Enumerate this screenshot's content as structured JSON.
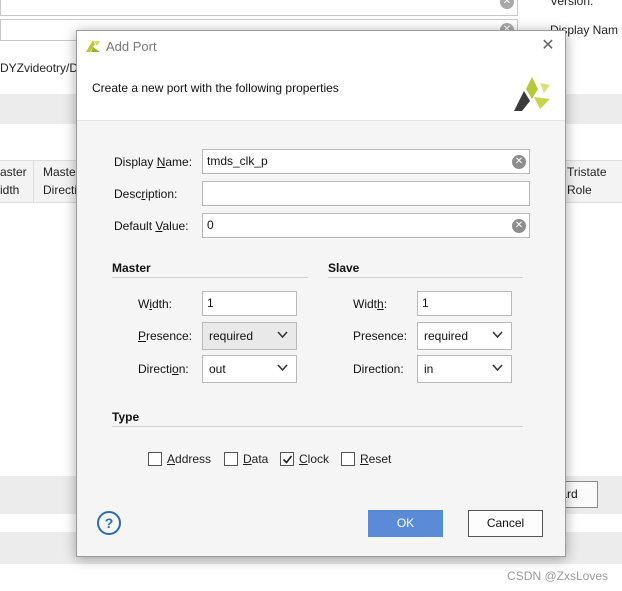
{
  "background": {
    "top_right_label_1": "Version:",
    "top_right_label_2": "Display Nam",
    "path_text": "DYZvideotry/DV",
    "columns_left": [
      {
        "line1": "aster",
        "line2": "idth"
      },
      {
        "line1": "Maste",
        "line2": "Directi"
      }
    ],
    "column_right": {
      "line1": "Tristate",
      "line2": "Role"
    },
    "button_fragment": "ard"
  },
  "watermark": "CSDN @ZxsLoves",
  "dialog": {
    "title": "Add Port",
    "subtitle": "Create a new port with the following properties",
    "fields": {
      "display_name": {
        "label_pre": "Display ",
        "label_key": "N",
        "label_post": "ame:",
        "value": "tmds_clk_p"
      },
      "description": {
        "label_pre": "Desc",
        "label_key": "r",
        "label_post": "iption:",
        "value": ""
      },
      "default_value": {
        "label_pre": "Default ",
        "label_key": "V",
        "label_post": "alue:",
        "value": "0"
      }
    },
    "master": {
      "title": "Master",
      "width_label_pre": "W",
      "width_label_key": "i",
      "width_label_post": "dth:",
      "width_value": "1",
      "presence_label_pre": "",
      "presence_label_key": "P",
      "presence_label_post": "resence:",
      "presence_value": "required",
      "direction_label_pre": "Directi",
      "direction_label_key": "o",
      "direction_label_post": "n:",
      "direction_value": "out"
    },
    "slave": {
      "title": "Slave",
      "width_label_pre": "Widt",
      "width_label_key": "h",
      "width_label_post": ":",
      "width_value": "1",
      "presence_label": "Presence:",
      "presence_value": "required",
      "direction_label": "Direction:",
      "direction_value": "in"
    },
    "type": {
      "title": "Type",
      "options": [
        {
          "pre": "",
          "key": "A",
          "post": "ddress",
          "checked": false
        },
        {
          "pre": "",
          "key": "D",
          "post": "ata",
          "checked": false
        },
        {
          "pre": "",
          "key": "C",
          "post": "lock",
          "checked": true
        },
        {
          "pre": "",
          "key": "R",
          "post": "eset",
          "checked": false
        }
      ]
    },
    "help_label": "?",
    "ok_label": "OK",
    "cancel_label": "Cancel",
    "colors": {
      "ok": "#5b8bd6",
      "logo_yellow": "#b6c93a",
      "logo_dark": "#3a3a3a"
    }
  }
}
